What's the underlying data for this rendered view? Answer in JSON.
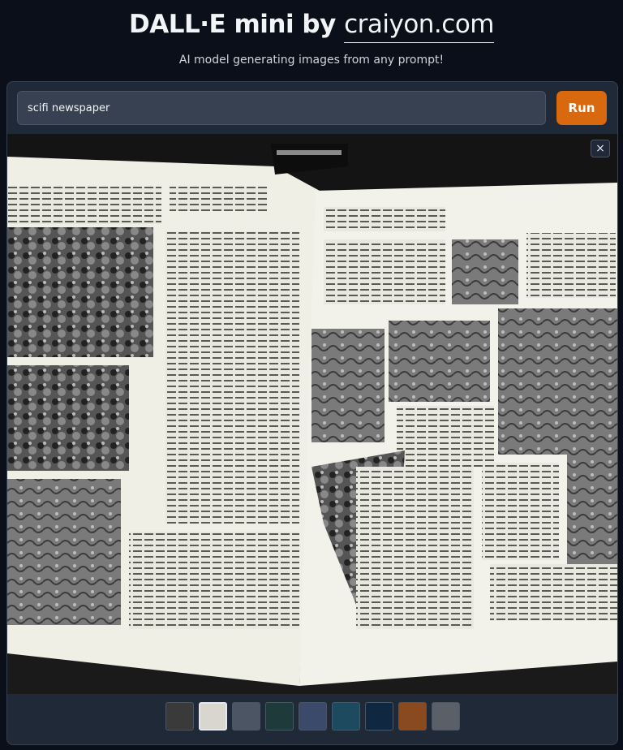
{
  "header": {
    "title_prefix": "DALL·E mini by ",
    "title_brand": "craiyon.com",
    "subtitle": "AI model generating images from any prompt!"
  },
  "prompt": {
    "value": "scifi newspaper"
  },
  "run_label": "Run",
  "close_label": "×",
  "result_image": {
    "alt": "Generated image: open newspaper spread with black and white photo panels and columns of text"
  },
  "thumbnails": [
    {
      "name": "thumbnail-1",
      "color": "#3a3a3a"
    },
    {
      "name": "thumbnail-2",
      "color": "#d8d6cf"
    },
    {
      "name": "thumbnail-3",
      "color": "#4b5563"
    },
    {
      "name": "thumbnail-4",
      "color": "#1f3a3a"
    },
    {
      "name": "thumbnail-5",
      "color": "#3b4a6b"
    },
    {
      "name": "thumbnail-6",
      "color": "#1d4a5e"
    },
    {
      "name": "thumbnail-7",
      "color": "#0f2740"
    },
    {
      "name": "thumbnail-8",
      "color": "#8a4a1f"
    },
    {
      "name": "thumbnail-9",
      "color": "#5b6068"
    }
  ]
}
